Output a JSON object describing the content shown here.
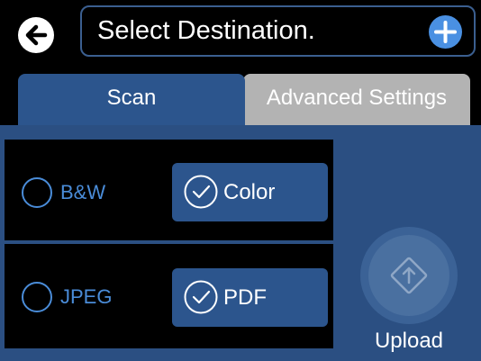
{
  "header": {
    "back_icon": "arrow-left-icon",
    "destination_text": "Select Destination.",
    "add_icon": "plus-icon"
  },
  "tabs": [
    {
      "label": "Scan",
      "selected": true
    },
    {
      "label": "Advanced Settings",
      "selected": false
    }
  ],
  "color_mode": {
    "options": [
      {
        "label": "B&W",
        "selected": false
      },
      {
        "label": "Color",
        "selected": true
      }
    ]
  },
  "file_format": {
    "options": [
      {
        "label": "JPEG",
        "selected": false
      },
      {
        "label": "PDF",
        "selected": true
      }
    ]
  },
  "upload": {
    "label": "Upload",
    "icon": "diamond-upload-icon"
  },
  "colors": {
    "accent_blue": "#2c558d",
    "panel_blue": "#2b4f82",
    "unselected_blue": "#4a8cd8",
    "add_button": "#4a90e2",
    "inactive_tab": "#b3b3b3"
  }
}
